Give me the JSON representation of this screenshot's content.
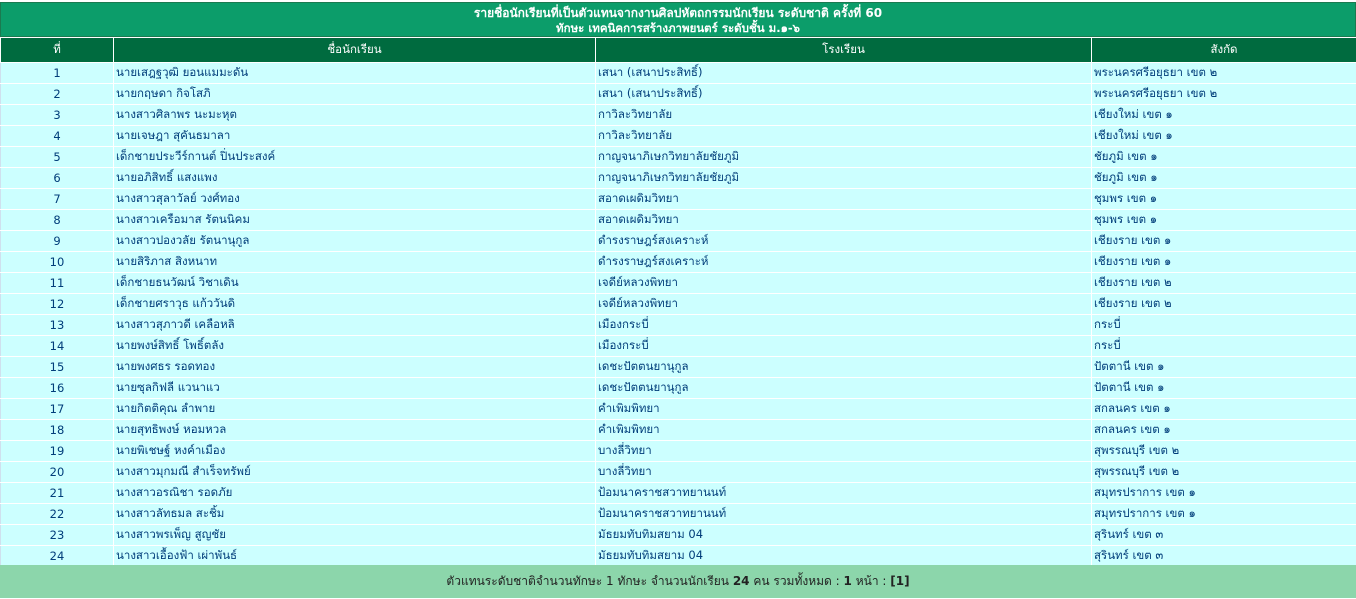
{
  "header": {
    "title_line1": "รายชื่อนักเรียนที่เป็นตัวแทนจากงานศิลปหัตถกรรมนักเรียน ระดับชาติ ครั้งที่ 60",
    "title_line2": "ทักษะ เทคนิคการสร้างภาพยนตร์ ระดับชั้น ม.๑-๖"
  },
  "table": {
    "columns": [
      "ที่",
      "ชื่อนักเรียน",
      "โรงเรียน",
      "สังกัด"
    ],
    "rows": [
      {
        "no": "1",
        "name": "นายเสฎฐวุฒิ   ยอนแมมะดัน",
        "school": "เสนา (เสนาประสิทธิ์)",
        "area": "พระนครศรีอยุธยา เขต ๒"
      },
      {
        "no": "2",
        "name": "นายกฤษดา   กิจโสภิ",
        "school": "เสนา (เสนาประสิทธิ์)",
        "area": "พระนครศรีอยุธยา เขต ๒"
      },
      {
        "no": "3",
        "name": "นางสาวศิลาพร   นะมะหุต",
        "school": "กาวิละวิทยาลัย",
        "area": "เชียงใหม่ เขต ๑"
      },
      {
        "no": "4",
        "name": "นายเจษฎา   สุคันธมาลา",
        "school": "กาวิละวิทยาลัย",
        "area": "เชียงใหม่ เขต ๑"
      },
      {
        "no": "5",
        "name": "เด็กชายประวีร์กานต์   ปิ่นประสงค์",
        "school": "กาญจนาภิเษกวิทยาลัยชัยภูมิ",
        "area": "ชัยภูมิ เขต ๑"
      },
      {
        "no": "6",
        "name": "นายอภิสิทธิ์   แสงแพง",
        "school": "กาญจนาภิเษกวิทยาลัยชัยภูมิ",
        "area": "ชัยภูมิ เขต ๑"
      },
      {
        "no": "7",
        "name": "นางสาวสุลาวัลย์   วงศ์ทอง",
        "school": "สอาดเผดิมวิทยา",
        "area": "ชุมพร เขต ๑"
      },
      {
        "no": "8",
        "name": "นางสาวเครือมาส   รัตนนิคม",
        "school": "สอาดเผดิมวิทยา",
        "area": "ชุมพร เขต ๑"
      },
      {
        "no": "9",
        "name": "นางสาวปองวลัย   รัตนานุกูล",
        "school": "ดำรงราษฎร์สงเคราะห์",
        "area": "เชียงราย เขต ๑"
      },
      {
        "no": "10",
        "name": "นายสิริภาส   สิงหนาท",
        "school": "ดำรงราษฎร์สงเคราะห์",
        "area": "เชียงราย เขต ๑"
      },
      {
        "no": "11",
        "name": "เด็กชายธนวัฒน์   วิชาเดิน",
        "school": "เจดีย์หลวงพิทยา",
        "area": "เชียงราย เขต ๒"
      },
      {
        "no": "12",
        "name": "เด็กชายศราวุธ   แก้ววันดิ",
        "school": "เจดีย์หลวงพิทยา",
        "area": "เชียงราย เขต ๒"
      },
      {
        "no": "13",
        "name": "นางสาวสุภาวดี   เคลือหลิ",
        "school": "เมืองกระบี่",
        "area": "กระบี่"
      },
      {
        "no": "14",
        "name": "นายพงษ์สิทธิ์   โพธิ์ตลัง",
        "school": "เมืองกระบี่",
        "area": "กระบี่"
      },
      {
        "no": "15",
        "name": "นายพงศธร   รอดทอง",
        "school": "เดชะปัตตนยานุกูล",
        "area": "ปัตตานี เขต ๑"
      },
      {
        "no": "16",
        "name": "นายซุลกิฟลี   แวนาแว",
        "school": "เดชะปัตตนยานุกูล",
        "area": "ปัตตานี เขต ๑"
      },
      {
        "no": "17",
        "name": "นายกิตติคุณ   ลำพาย",
        "school": "คำเพิมพิทยา",
        "area": "สกลนคร เขต ๑"
      },
      {
        "no": "18",
        "name": "นายสุทธิพงษ์   หอมหวล",
        "school": "คำเพิมพิทยา",
        "area": "สกลนคร เขต ๑"
      },
      {
        "no": "19",
        "name": "นายพิเชษฐ์   หงค์าเมือง",
        "school": "บางลี่วิทยา",
        "area": "สุพรรณบุรี เขต ๒"
      },
      {
        "no": "20",
        "name": "นางสาวมุกมณี   สำเร็จทรัพย์",
        "school": "บางลี่วิทยา",
        "area": "สุพรรณบุรี เขต ๒"
      },
      {
        "no": "21",
        "name": "นางสาวอรณิชา   รอดภัย",
        "school": "ป้อมนาคราชสวาทยานนท์",
        "area": "สมุทรปราการ เขต ๑"
      },
      {
        "no": "22",
        "name": "นางสาวลัทธมล   สะชิ้ม",
        "school": "ป้อมนาคราชสวาทยานนท์",
        "area": "สมุทรปราการ เขต ๑"
      },
      {
        "no": "23",
        "name": "นางสาวพรเพ็ญ   สูญชัย",
        "school": "มัธยมทับทิมสยาม 04",
        "area": "สุรินทร์ เขต ๓"
      },
      {
        "no": "24",
        "name": "นางสาวเอื้องฟ้า   เผ่าพันธ์",
        "school": "มัธยมทับทิมสยาม 04",
        "area": "สุรินทร์ เขต ๓"
      }
    ]
  },
  "footer": {
    "prefix": "ตัวแทนระดับชาติจำนวนทักษะ 1 ทักษะ จำนวนนักเรียน ",
    "student_count": "24",
    "middle": " คน รวมทั้งหมด : ",
    "total_pages": "1",
    "pages_label": " หน้า : ",
    "page_link": "[1]"
  },
  "colors": {
    "title_bg": "#0c9d6a",
    "header_bg": "#006b3f",
    "row_bg": "#ccffff",
    "row_text": "#003d7a",
    "footer_bg": "#8cd6ab"
  }
}
